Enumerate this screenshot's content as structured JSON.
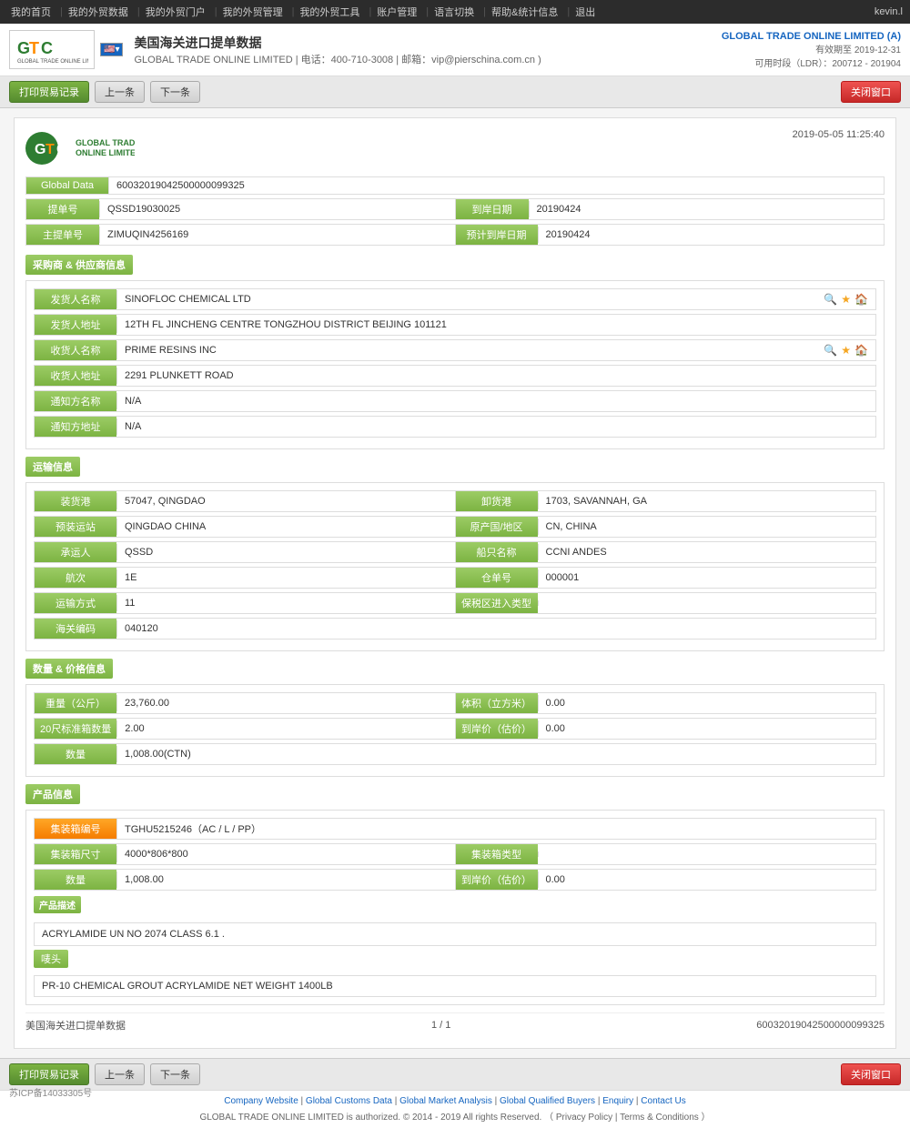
{
  "topnav": {
    "items": [
      "我的首页",
      "我的外贸数据",
      "我的外贸门户",
      "我的外贸管理",
      "我的外贸工具",
      "账户管理",
      "语言切换",
      "帮助&统计信息",
      "退出"
    ],
    "user": "kevin.l"
  },
  "header": {
    "company": "GLOBAL TRADE ONLINE LIMITED (A)",
    "valid_until": "有效期至 2019-12-31",
    "ldr": "可用时段（LDR）：200712 - 201904",
    "title": "美国海关进口提单数据",
    "sub_title": "GLOBAL TRADE ONLINE LIMITED | 电话：400-710-3008 | 邮箱：vip@pierschina.com.cn )"
  },
  "toolbar": {
    "print_btn": "打印贸易记录",
    "prev_btn": "上一条",
    "next_btn": "下一条",
    "close_btn": "关闭窗口"
  },
  "document": {
    "logo_text": "GTC",
    "logo_sub": "GLOBAL TRADE ONLINE LIMITED",
    "timestamp": "2019-05-05 11:25:40",
    "global_data_label": "Global Data",
    "global_data_value": "60032019042500000099325",
    "bill_no_label": "提单号",
    "bill_no_value": "QSSD19030025",
    "arrive_date_label": "到岸日期",
    "arrive_date_value": "20190424",
    "master_bill_label": "主提单号",
    "master_bill_value": "ZIMUQIN4256169",
    "est_arrive_label": "预计到岸日期",
    "est_arrive_value": "20190424"
  },
  "buyer_supplier": {
    "section_title": "采购商 & 供应商信息",
    "shipper_name_label": "发货人名称",
    "shipper_name_value": "SINOFLOC CHEMICAL LTD",
    "shipper_addr_label": "发货人地址",
    "shipper_addr_value": "12TH FL JINCHENG CENTRE TONGZHOU DISTRICT BEIJING 101121",
    "consignee_name_label": "收货人名称",
    "consignee_name_value": "PRIME RESINS INC",
    "consignee_addr_label": "收货人地址",
    "consignee_addr_value": "2291 PLUNKETT ROAD",
    "notify_name_label": "通知方名称",
    "notify_name_value": "N/A",
    "notify_addr_label": "通知方地址",
    "notify_addr_value": "N/A"
  },
  "transport": {
    "section_title": "运输信息",
    "load_port_label": "装货港",
    "load_port_value": "57047, QINGDAO",
    "unload_port_label": "卸货港",
    "unload_port_value": "1703, SAVANNAH, GA",
    "pre_load_label": "预装运站",
    "pre_load_value": "QINGDAO CHINA",
    "origin_label": "原产国/地区",
    "origin_value": "CN, CHINA",
    "carrier_label": "承运人",
    "carrier_value": "QSSD",
    "vessel_label": "船只名称",
    "vessel_value": "CCNI ANDES",
    "voyage_label": "航次",
    "voyage_value": "1E",
    "warehouse_label": "仓单号",
    "warehouse_value": "000001",
    "transport_mode_label": "运输方式",
    "transport_mode_value": "11",
    "bonded_label": "保税区进入类型",
    "bonded_value": "",
    "customs_code_label": "海关编码",
    "customs_code_value": "040120"
  },
  "quantity_price": {
    "section_title": "数量 & 价格信息",
    "weight_label": "重量（公斤）",
    "weight_value": "23,760.00",
    "volume_label": "体积（立方米）",
    "volume_value": "0.00",
    "container_20_label": "20尺标准箱数量",
    "container_20_value": "2.00",
    "arrive_price_label": "到岸价（估价）",
    "arrive_price_value": "0.00",
    "quantity_label": "数量",
    "quantity_value": "1,008.00(CTN)"
  },
  "product": {
    "section_title": "产品信息",
    "container_no_label": "集装箱编号",
    "container_no_value": "TGHU5215246（AC / L / PP）",
    "container_size_label": "集装箱尺寸",
    "container_size_value": "4000*806*800",
    "container_type_label": "集装箱类型",
    "container_type_value": "",
    "quantity_label": "数量",
    "quantity_value": "1,008.00",
    "arrive_price_label": "到岸价（估价）",
    "arrive_price_value": "0.00",
    "desc_label": "产品描述",
    "desc_value": "ACRYLAMIDE UN NO 2074 CLASS 6.1 .",
    "marks_label": "唛头",
    "marks_value": "PR-10 CHEMICAL GROUT ACRYLAMIDE NET WEIGHT 1400LB"
  },
  "doc_footer": {
    "title": "美国海关进口提单数据",
    "page": "1 / 1",
    "record_no": "60032019042500000099325"
  },
  "bottom_toolbar": {
    "print_btn": "打印贸易记录",
    "prev_btn": "上一条",
    "next_btn": "下一条",
    "close_btn": "关闭窗口"
  },
  "site_footer": {
    "links": [
      "Company Website",
      "Global Customs Data",
      "Global Market Analysis",
      "Global Qualified Buyers",
      "Enquiry",
      "Contact Us"
    ],
    "copyright": "GLOBAL TRADE ONLINE LIMITED is authorized. © 2014 - 2019 All rights Reserved. （ Privacy Policy | Terms & Conditions ）",
    "icp": "苏ICP备14033305号"
  }
}
